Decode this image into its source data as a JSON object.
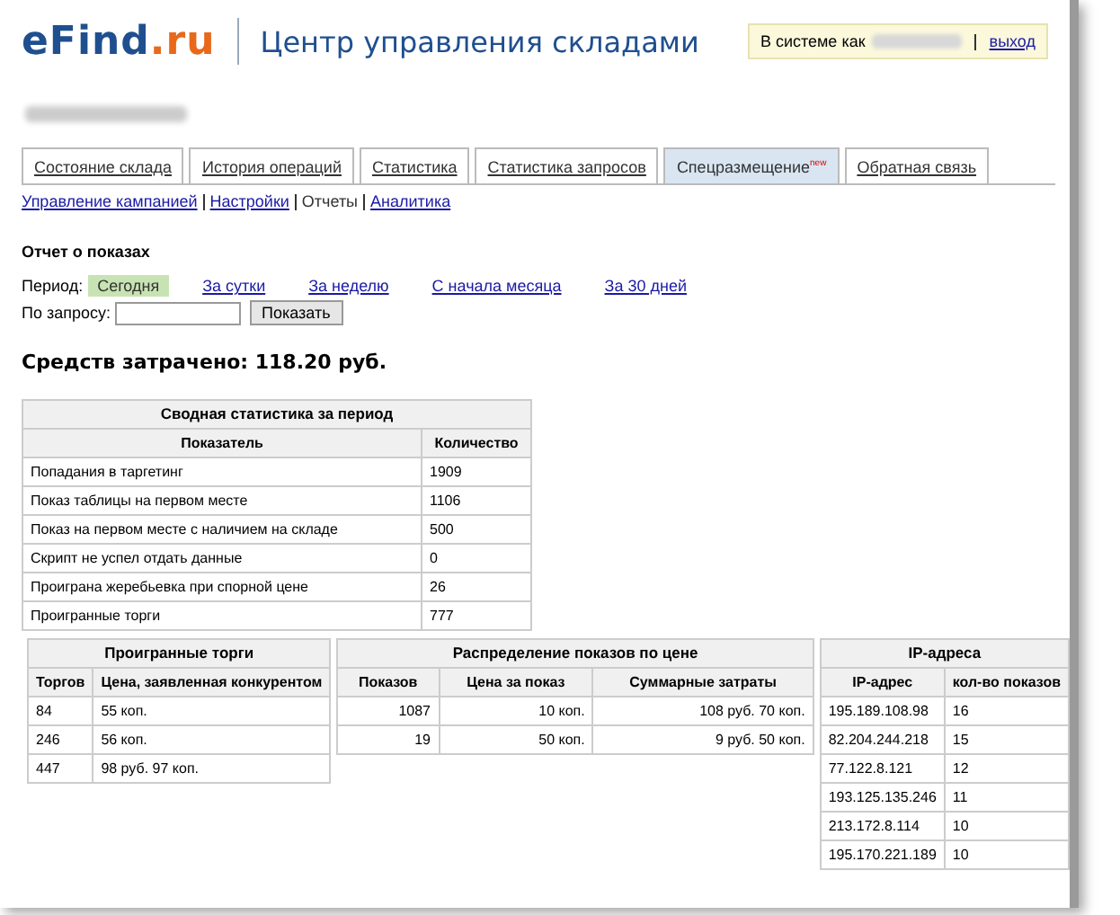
{
  "header": {
    "logo_main": "eFind",
    "logo_domain": ".ru",
    "title": "Центр управления складами",
    "session_label": "В системе как",
    "logout": "выход"
  },
  "tabs": [
    {
      "label": "Состояние склада",
      "selected": false
    },
    {
      "label": "История операций",
      "selected": false
    },
    {
      "label": "Статистика",
      "selected": false
    },
    {
      "label": "Статистика запросов",
      "selected": false
    },
    {
      "label": "Спецразмещение",
      "badge": "new",
      "selected": true
    },
    {
      "label": "Обратная связь",
      "selected": false
    }
  ],
  "subnav": [
    {
      "label": "Управление кампанией",
      "selected": false
    },
    {
      "label": "Настройки",
      "selected": false
    },
    {
      "label": "Отчеты",
      "selected": true
    },
    {
      "label": "Аналитика",
      "selected": false
    }
  ],
  "report": {
    "title": "Отчет о показах",
    "period_label": "Период:",
    "periods": [
      {
        "label": "Сегодня",
        "selected": true
      },
      {
        "label": "За сутки",
        "selected": false
      },
      {
        "label": "За неделю",
        "selected": false
      },
      {
        "label": "С начала месяца",
        "selected": false
      },
      {
        "label": "За 30 дней",
        "selected": false
      }
    ],
    "query_label": "По запросу:",
    "show_button": "Показать",
    "spent": "Средств затрачено: 118.20 руб."
  },
  "summary": {
    "caption": "Сводная статистика за период",
    "columns": [
      "Показатель",
      "Количество"
    ],
    "rows": [
      [
        "Попадания в таргетинг",
        "1909"
      ],
      [
        "Показ таблицы на первом месте",
        "1106"
      ],
      [
        "Показ на первом месте с наличием на складе",
        "500"
      ],
      [
        "Скрипт не успел отдать данные",
        "0"
      ],
      [
        "Проиграна жеребьевка при спорной цене",
        "26"
      ],
      [
        "Проигранные торги",
        "777"
      ]
    ]
  },
  "lost": {
    "caption": "Проигранные торги",
    "columns": [
      "Торгов",
      "Цена, заявленная конкурентом"
    ],
    "rows": [
      [
        "84",
        "55 коп."
      ],
      [
        "246",
        "56 коп."
      ],
      [
        "447",
        "98 руб. 97 коп."
      ]
    ]
  },
  "distribution": {
    "caption": "Распределение показов по цене",
    "columns": [
      "Показов",
      "Цена за показ",
      "Суммарные затраты"
    ],
    "rows": [
      [
        "1087",
        "10 коп.",
        "108 руб. 70 коп."
      ],
      [
        "19",
        "50 коп.",
        "9 руб. 50 коп."
      ]
    ]
  },
  "ips": {
    "caption": "IP-адреса",
    "columns": [
      "IP-адрес",
      "кол-во показов"
    ],
    "rows": [
      [
        "195.189.108.98",
        "16"
      ],
      [
        "82.204.244.218",
        "15"
      ],
      [
        "77.122.8.121",
        "12"
      ],
      [
        "193.125.135.246",
        "11"
      ],
      [
        "213.172.8.114",
        "10"
      ],
      [
        "195.170.221.189",
        "10"
      ]
    ]
  }
}
